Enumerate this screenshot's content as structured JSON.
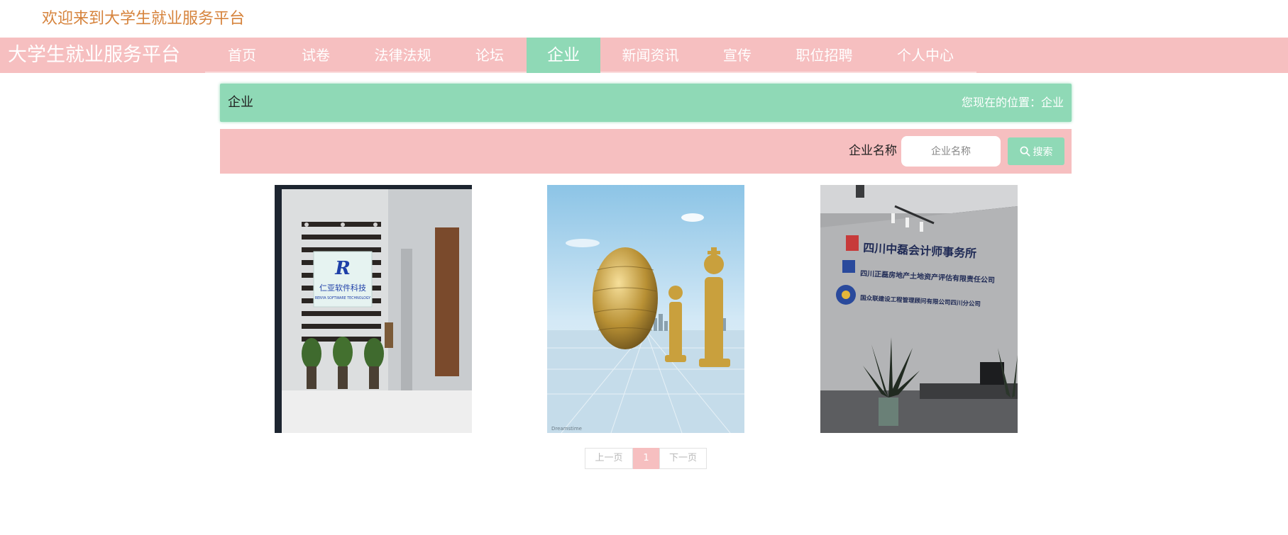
{
  "welcome": "欢迎来到大学生就业服务平台",
  "brand": "大学生就业服务平台",
  "nav": [
    {
      "label": "首页"
    },
    {
      "label": "试卷"
    },
    {
      "label": "法律法规"
    },
    {
      "label": "论坛"
    },
    {
      "label": "企业",
      "active": true
    },
    {
      "label": "新闻资讯"
    },
    {
      "label": "宣传"
    },
    {
      "label": "职位招聘"
    },
    {
      "label": "个人中心"
    }
  ],
  "breadcrumb": {
    "title": "企业",
    "position_label": "您现在的位置：",
    "position_value": "企业"
  },
  "search": {
    "label": "企业名称",
    "placeholder": "企业名称",
    "value": "",
    "button_label": "搜索",
    "button_icon": "search-icon"
  },
  "companies": [
    {
      "logo_text": "仁亚软件科技",
      "logo_subtext": "RENYA SOFTWARE TECHNOLOGY",
      "image": "office-lobby-wall-logo"
    },
    {
      "image": "golden-globe-and-chess-pieces",
      "watermark": "Dreamstime"
    },
    {
      "image": "reception-wall-with-company-names",
      "wall_lines": [
        "四川中磊会计师事务所",
        "四川正磊房地产土地资产评估有限责任公司",
        "国众联建设工程管理顾问有限公司四川分公司"
      ]
    }
  ],
  "pagination": {
    "prev": "上一页",
    "current": "1",
    "next": "下一页"
  },
  "colors": {
    "pink": "#f6bfc0",
    "green": "#8fd9b6",
    "welcome_text": "#d6833c"
  }
}
